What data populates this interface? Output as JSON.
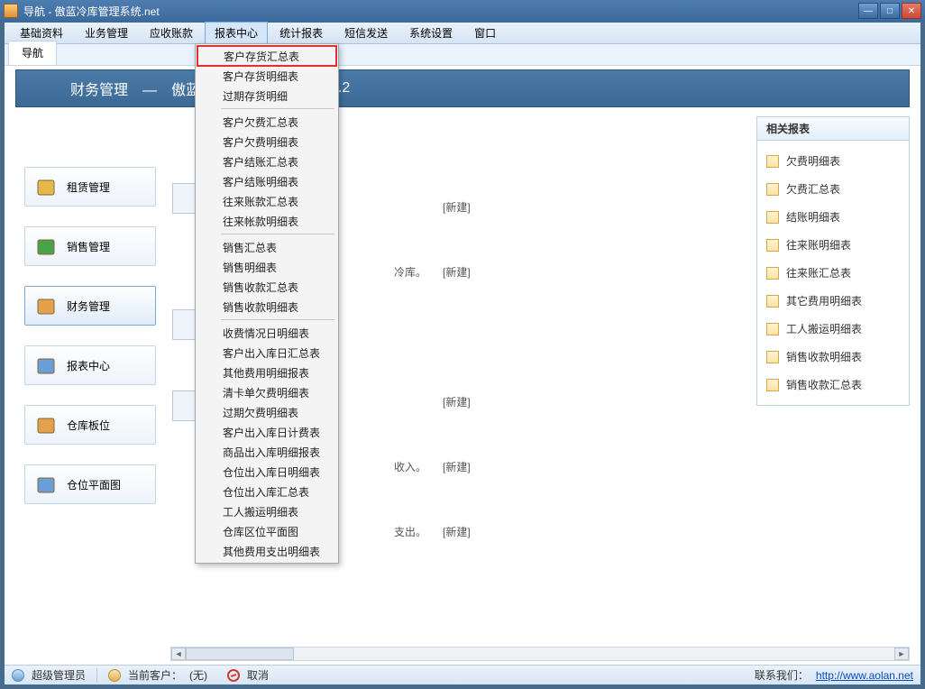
{
  "window": {
    "title": "导航 - 傲蓝冷库管理系统.net"
  },
  "menubar": [
    "基础资料",
    "业务管理",
    "应收账款",
    "报表中心",
    "统计报表",
    "短信发送",
    "系统设置",
    "窗口"
  ],
  "active_menu_index": 3,
  "tab": {
    "label": "导航"
  },
  "header": {
    "title": "财务管理　—　傲蓝冷",
    "version": "v5.2"
  },
  "nav_cards": [
    {
      "label": "租赁管理",
      "icon_color": "#e4b94a"
    },
    {
      "label": "销售管理",
      "icon_color": "#4aa24a"
    },
    {
      "label": "财务管理",
      "icon_color": "#e4a04a",
      "active": true
    },
    {
      "label": "报表中心",
      "icon_color": "#6a9ed8"
    },
    {
      "label": "仓库板位",
      "icon_color": "#e4a04a"
    },
    {
      "label": "仓位平面图",
      "icon_color": "#6a9ed8"
    }
  ],
  "main_rows": [
    {
      "text": "",
      "new": "[新建]"
    },
    {
      "text": "冷库。",
      "new": "[新建]"
    },
    {
      "text": "",
      "new": ""
    },
    {
      "text": "",
      "new": "[新建]"
    },
    {
      "text": "收入。",
      "new": "[新建]"
    },
    {
      "text": "支出。",
      "new": "[新建]"
    }
  ],
  "dropdown": {
    "groups": [
      [
        "客户存货汇总表",
        "客户存货明细表",
        "过期存货明细"
      ],
      [
        "客户欠费汇总表",
        "客户欠费明细表",
        "客户结账汇总表",
        "客户结账明细表",
        "往来账款汇总表",
        "往来帐款明细表"
      ],
      [
        "销售汇总表",
        "销售明细表",
        "销售收款汇总表",
        "销售收款明细表"
      ],
      [
        "收费情况日明细表",
        "客户出入库日汇总表",
        "其他费用明细报表",
        "清卡单欠费明细表",
        "过期欠费明细表",
        "客户出入库日计费表",
        "商品出入库明细报表",
        "仓位出入库日明细表",
        "仓位出入库汇总表",
        "工人搬运明细表",
        "仓库区位平面图",
        "其他费用支出明细表"
      ]
    ],
    "highlighted": "客户存货汇总表"
  },
  "right_panel": {
    "title": "相关报表",
    "items": [
      "欠费明细表",
      "欠费汇总表",
      "结账明细表",
      "往来账明细表",
      "往来账汇总表",
      "其它费用明细表",
      "工人搬运明细表",
      "销售收款明细表",
      "销售收款汇总表"
    ]
  },
  "statusbar": {
    "user_label": "超级管理员",
    "customer_label": "当前客户：",
    "customer_value": "(无)",
    "cancel": "取消",
    "contact_label": "联系我们：",
    "contact_url": "http://www.aolan.net"
  }
}
